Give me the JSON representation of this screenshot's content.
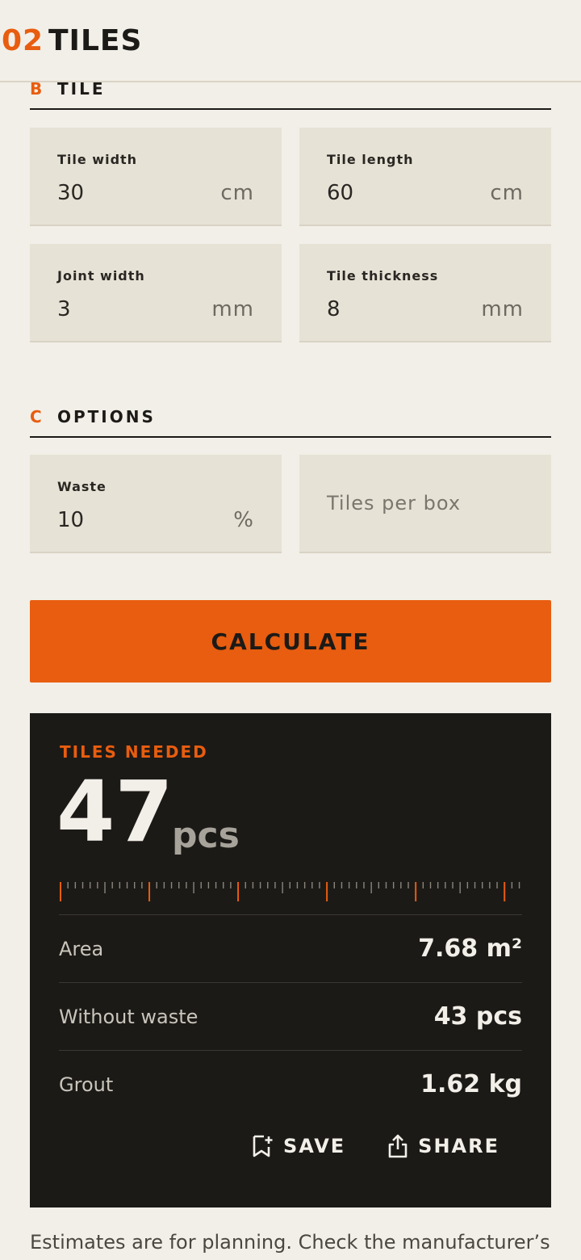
{
  "header": {
    "number": "02",
    "title": "TILES"
  },
  "section_b": {
    "letter": "B",
    "label": "TILE"
  },
  "fields_tile": [
    {
      "label": "Tile width",
      "value": "30",
      "unit": "cm"
    },
    {
      "label": "Tile length",
      "value": "60",
      "unit": "cm"
    },
    {
      "label": "Joint width",
      "value": "3",
      "unit": "mm"
    },
    {
      "label": "Tile thickness",
      "value": "8",
      "unit": "mm"
    }
  ],
  "section_c": {
    "letter": "C",
    "label": "OPTIONS"
  },
  "fields_options": {
    "waste": {
      "label": "Waste",
      "value": "10",
      "unit": "%"
    },
    "tiles_per_box": {
      "placeholder": "Tiles per box"
    }
  },
  "calculate_label": "CALCULATE",
  "result": {
    "label": "TILES NEEDED",
    "value": "47",
    "unit": "pcs",
    "rows": [
      {
        "label": "Area",
        "value": "7.68 m²"
      },
      {
        "label": "Without waste",
        "value": "43 pcs"
      },
      {
        "label": "Grout",
        "value": "1.62 kg"
      }
    ],
    "save_label": "SAVE",
    "share_label": "SHARE"
  },
  "footer_note": "Estimates are for planning. Check the manufacturer’s",
  "colors": {
    "accent": "#e85d0f",
    "background": "#f2efe8",
    "panel": "#1c1a17",
    "field": "#e6e2d6"
  },
  "icons": {
    "save": "bookmark-add-icon",
    "share": "share-icon"
  }
}
